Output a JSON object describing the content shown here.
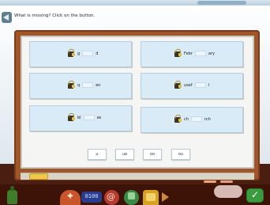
{
  "instruction": {
    "text": "What is missing? Click on the button."
  },
  "words": [
    {
      "prefix": "g",
      "suffix": "d"
    },
    {
      "prefix": "Febr",
      "suffix": "ary"
    },
    {
      "prefix": "q",
      "suffix": "en"
    },
    {
      "prefix": "usef",
      "suffix": "l"
    },
    {
      "prefix": "bl",
      "suffix": "se"
    },
    {
      "prefix": "ch",
      "suffix": "rch"
    }
  ],
  "options": [
    "u",
    "ue",
    "oo",
    "ou"
  ],
  "toolbar": {
    "clock_display": "0100"
  },
  "colors": {
    "card_fill": "#d9ebf7",
    "board_frame": "#a0562b",
    "ok_button": "#3a9b3f"
  },
  "icons": {
    "speaker": "speaker-icon",
    "lock": "padlock-icon",
    "ok": "check-icon"
  }
}
